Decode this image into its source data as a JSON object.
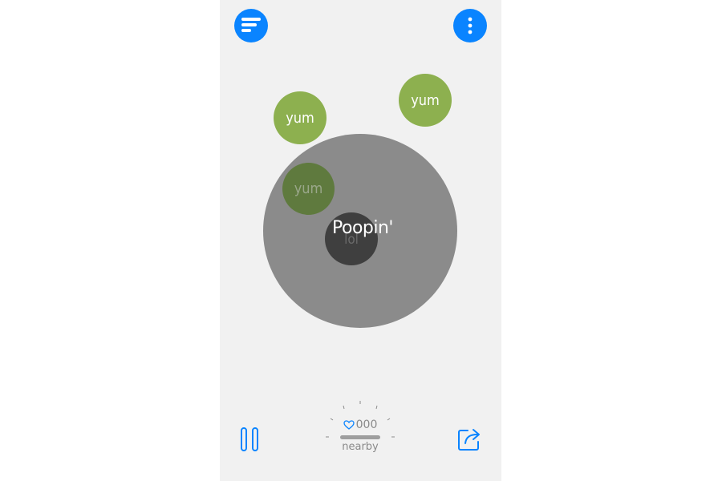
{
  "colors": {
    "accent": "#0a84ff",
    "phone_background": "#f1f1f1",
    "big_circle": "#8b8b8b",
    "green_bubble": "#8db04f",
    "green_bubble_dim": "#5f7a3e",
    "dark_bubble": "#3f3f3f"
  },
  "header": {
    "menu_icon": "lines-menu-icon",
    "more_icon": "vertical-dots-icon"
  },
  "bubbles": {
    "green_1_label": "yum",
    "green_2_label": "yum",
    "green_dim_label": "yum",
    "dark_label": "lol",
    "center_label": "Poopin'"
  },
  "footer": {
    "pause_icon": "pause-icon",
    "share_icon": "share-icon",
    "heart_icon": "heart-icon",
    "count": "000",
    "nearby_label": "nearby"
  }
}
